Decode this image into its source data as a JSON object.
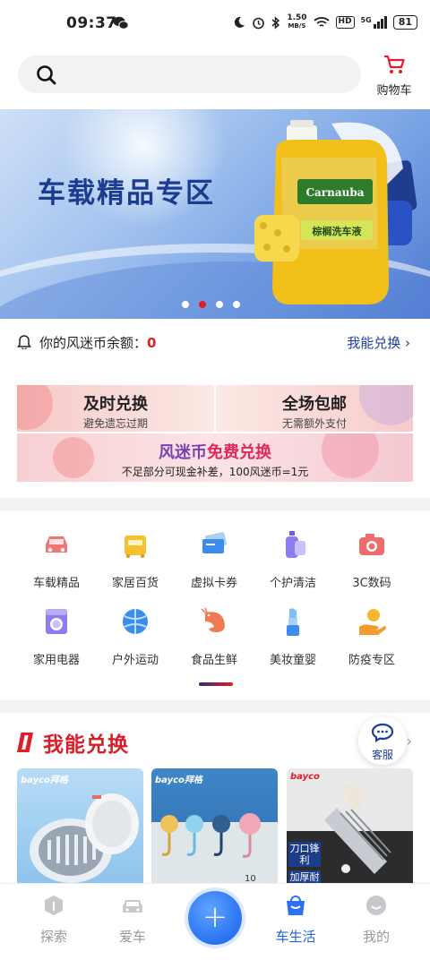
{
  "status_bar": {
    "time": "09:37",
    "net_speed_top": "1.50",
    "net_speed_unit": "MB/S",
    "hd": "HD",
    "signal_label": "5G",
    "battery": "81"
  },
  "header": {
    "search_placeholder": "",
    "cart_label": "购物车"
  },
  "banner": {
    "title": "车载精品专区",
    "product_label_1": "Carnauba",
    "product_label_2": "棕榈洗车液",
    "slide_count": 4,
    "active_slide": 2
  },
  "points": {
    "label": "你的风迷币余额：",
    "value": "0",
    "link": "我能兑换"
  },
  "promo": {
    "left_title": "及时兑换",
    "left_sub": "避免遗忘过期",
    "right_title": "全场包邮",
    "right_sub": "无需额外支付",
    "wide_title_a": "风迷币",
    "wide_title_b": "免费兑换",
    "wide_sub": "不足部分可现金补差，100风迷币=1元"
  },
  "categories": [
    {
      "label": "车载精品",
      "icon": "car-icon"
    },
    {
      "label": "家居百货",
      "icon": "home-goods-icon"
    },
    {
      "label": "虚拟卡券",
      "icon": "card-icon"
    },
    {
      "label": "个护清洁",
      "icon": "cleaning-icon"
    },
    {
      "label": "3C数码",
      "icon": "camera-icon"
    },
    {
      "label": "家用电器",
      "icon": "washer-icon"
    },
    {
      "label": "户外运动",
      "icon": "ball-icon"
    },
    {
      "label": "食品生鲜",
      "icon": "shrimp-icon"
    },
    {
      "label": "美妆童婴",
      "icon": "lipstick-icon"
    },
    {
      "label": "防疫专区",
      "icon": "hand-icon"
    }
  ],
  "section": {
    "title": "我能兑换",
    "service_label": "客服",
    "more": "›"
  },
  "products": [
    {
      "brand": "bayco拜格",
      "tags": []
    },
    {
      "brand": "bayco拜格",
      "tags": [],
      "number": "10"
    },
    {
      "brand": "bayco",
      "tags": [
        "刀口锋利",
        "加厚耐用"
      ]
    }
  ],
  "nav": [
    {
      "label": "探索",
      "icon": "explore-icon",
      "active": false
    },
    {
      "label": "爱车",
      "icon": "car-nav-icon",
      "active": false
    },
    {
      "label": "车生活",
      "icon": "shopping-bag-icon",
      "active": true
    },
    {
      "label": "我的",
      "icon": "profile-icon",
      "active": false
    }
  ],
  "nav_center": {
    "symbol": "+"
  },
  "colors": {
    "accent_red": "#e01e2a",
    "link_blue": "#1f3e9c",
    "nav_active": "#1f63d6"
  }
}
